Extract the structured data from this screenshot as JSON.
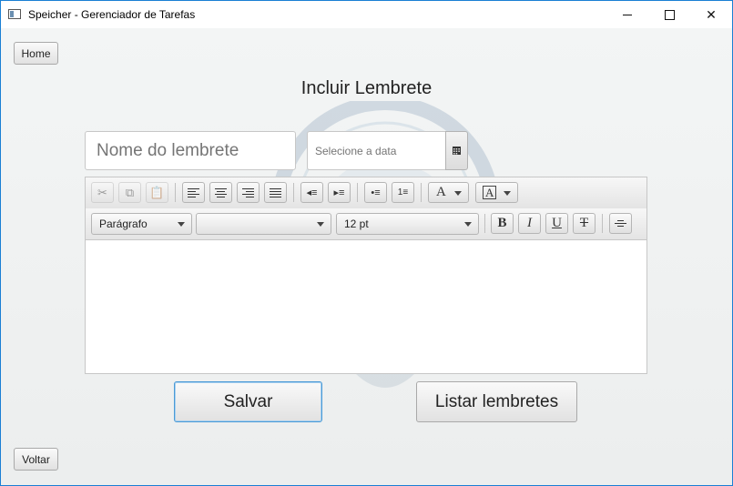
{
  "window": {
    "title": "Speicher - Gerenciador de Tarefas"
  },
  "nav": {
    "home_label": "Home",
    "back_label": "Voltar"
  },
  "page": {
    "title": "Incluir Lembrete"
  },
  "form": {
    "name_placeholder": "Nome do lembrete",
    "date_placeholder": "Selecione a data"
  },
  "editor": {
    "paragraph_style": "Parágrafo",
    "font_family": "",
    "font_size": "12 pt",
    "bold_label": "B",
    "italic_label": "I",
    "underline_label": "U",
    "strike_label": "T",
    "text_color_label": "A",
    "bg_color_label": "A"
  },
  "actions": {
    "save_label": "Salvar",
    "list_label": "Listar lembretes"
  },
  "colors": {
    "accent": "#4a9ad6",
    "window_border": "#1a7fd4"
  }
}
